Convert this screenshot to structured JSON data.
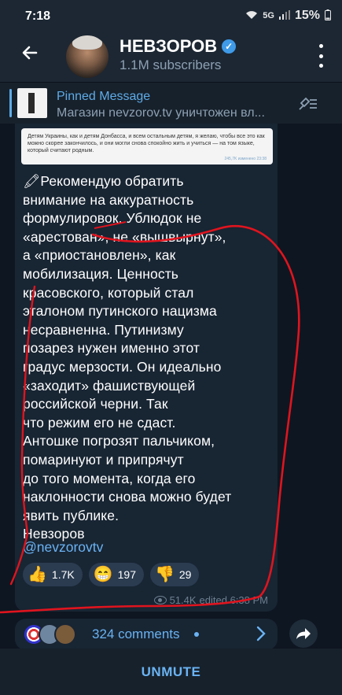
{
  "status_bar": {
    "time": "7:18",
    "network": "5G",
    "battery": "15%"
  },
  "header": {
    "back_icon": "back-arrow-icon",
    "title": "НЕВЗОРОВ",
    "verified_icon": "verified-badge-icon",
    "subtitle": "1.1M subscribers",
    "menu_icon": "more-vertical-icon"
  },
  "pinned": {
    "title": "Pinned Message",
    "text": "Магазин nevzorov.tv уничтожен вл...",
    "icon": "unpin-list-icon"
  },
  "message": {
    "quote_image_text": "Детям Украины, как и детям Донбасса, и всем остальным детям, я желаю, чтобы все это как можно скорее закончилось, и они могли снова спокойно жить и учиться — на том языке, который считают родным.",
    "quote_image_meta": "245,7K изменено 23:38",
    "body": "🖍Рекомендую обратить\nвнимание на аккуратность\nформулировок.  Ублюдок не\n«арестован», не «вышвырнут»,\nа «приостановлен», как\nмобилизация.  Ценность\nкрасовского, который стал\nэталоном путинского нацизма\nнесравненна.  Путинизму\nпозарез нужен  именно этот\nградус мерзости.  Он идеально\n«заходит» фашиствующей\nроссийской черни.  Так\nчто режим его не сдаст.\nАнтошке погрозят пальчиком,\nпомаринуют и припрячут\nдо того момента, когда его\nнаклонности снова можно будет\nявить публике.\nНевзоров",
    "link": "@nevzorovtv",
    "reactions": [
      {
        "emoji": "👍",
        "count": "1.7K"
      },
      {
        "emoji": "😁",
        "count": "197"
      },
      {
        "emoji": "👎",
        "count": "29"
      }
    ],
    "views": "51.4K",
    "edited_time": "edited 6:38 PM"
  },
  "comments": {
    "count_label": "324 comments",
    "chevron_icon": "chevron-right-icon",
    "share_icon": "share-arrow-icon"
  },
  "bottom": {
    "unmute_label": "UNMUTE"
  },
  "colors": {
    "background": "#0e1621",
    "header": "#1c2733",
    "bubble": "#182533",
    "accent": "#6ab3f3",
    "scribble": "#e0141e"
  }
}
